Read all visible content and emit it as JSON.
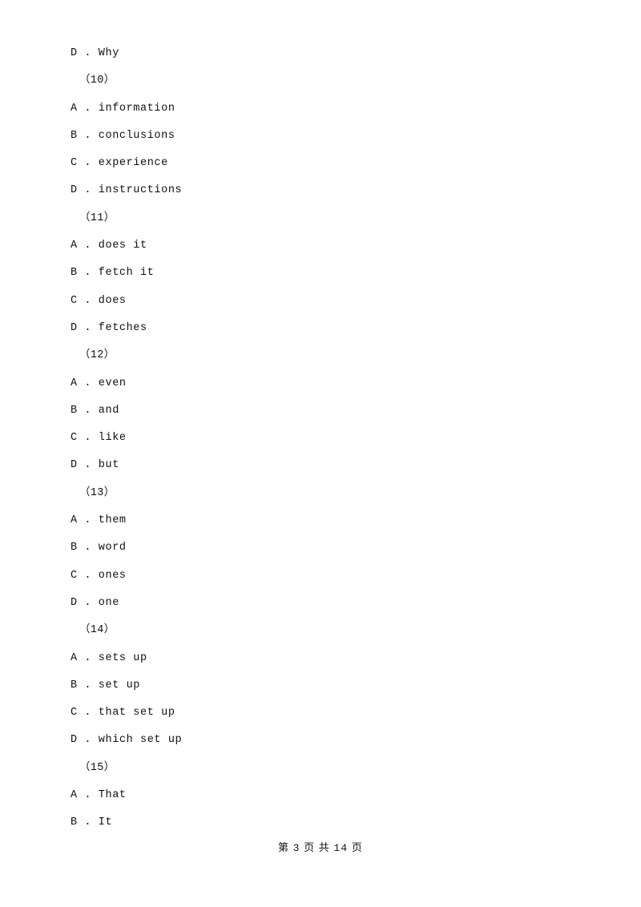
{
  "document": {
    "lines": [
      {
        "type": "option",
        "text": "D . Why"
      },
      {
        "type": "question",
        "text": "（10）"
      },
      {
        "type": "option",
        "text": "A . information"
      },
      {
        "type": "option",
        "text": "B . conclusions"
      },
      {
        "type": "option",
        "text": "C . experience"
      },
      {
        "type": "option",
        "text": "D . instructions"
      },
      {
        "type": "question",
        "text": "（11）"
      },
      {
        "type": "option",
        "text": "A . does it"
      },
      {
        "type": "option",
        "text": "B . fetch it"
      },
      {
        "type": "option",
        "text": "C . does"
      },
      {
        "type": "option",
        "text": "D . fetches"
      },
      {
        "type": "question",
        "text": "（12）"
      },
      {
        "type": "option",
        "text": "A . even"
      },
      {
        "type": "option",
        "text": "B . and"
      },
      {
        "type": "option",
        "text": "C . like"
      },
      {
        "type": "option",
        "text": "D . but"
      },
      {
        "type": "question",
        "text": "（13）"
      },
      {
        "type": "option",
        "text": "A . them"
      },
      {
        "type": "option",
        "text": "B . word"
      },
      {
        "type": "option",
        "text": "C . ones"
      },
      {
        "type": "option",
        "text": "D . one"
      },
      {
        "type": "question",
        "text": "（14）"
      },
      {
        "type": "option",
        "text": "A . sets up"
      },
      {
        "type": "option",
        "text": "B . set up"
      },
      {
        "type": "option",
        "text": "C . that set up"
      },
      {
        "type": "option",
        "text": "D . which set up"
      },
      {
        "type": "question",
        "text": "（15）"
      },
      {
        "type": "option",
        "text": "A . That"
      },
      {
        "type": "option",
        "text": "B . It"
      }
    ],
    "footer": {
      "prefix": "第",
      "current_page": "3",
      "middle": "页 共",
      "total_pages": "14",
      "suffix": "页"
    }
  }
}
